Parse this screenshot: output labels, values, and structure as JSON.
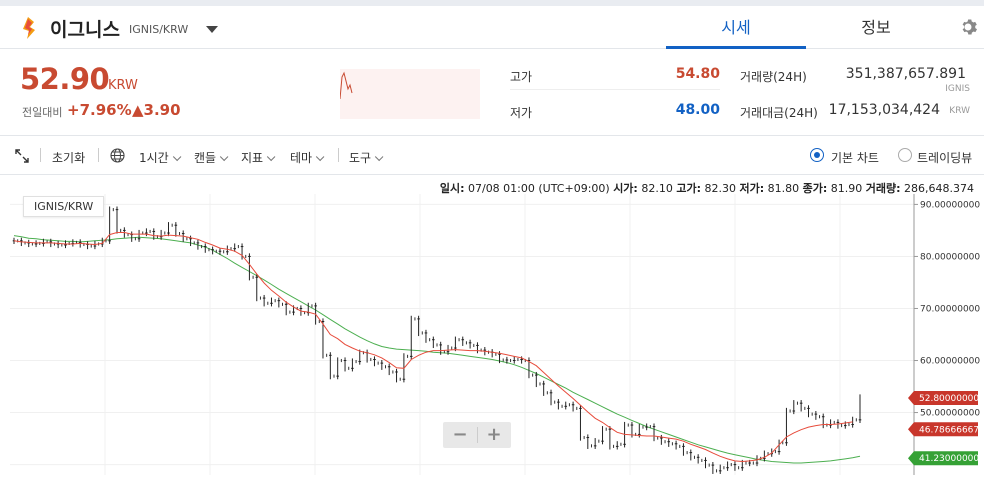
{
  "header": {
    "coin_name": "이그니스",
    "pair": "IGNIS/KRW",
    "tabs": [
      {
        "label": "시세"
      },
      {
        "label": "정보"
      }
    ]
  },
  "price": {
    "value": "52.90",
    "unit": "KRW",
    "change_label": "전일대비",
    "change_rate": "+7.96%",
    "change_amount": "▲3.90"
  },
  "stats": {
    "high_label": "고가",
    "high": "54.80",
    "low_label": "저가",
    "low": "48.00",
    "volume_label": "거래량(24H)",
    "volume": "351,387,657.891",
    "volume_unit": "IGNIS",
    "amount_label": "거래대금(24H)",
    "amount": "17,153,034,424",
    "amount_unit": "KRW"
  },
  "toolbar": {
    "reset": "초기화",
    "interval": "1시간",
    "candle": "캔들",
    "indicator": "지표",
    "theme": "테마",
    "tools": "도구",
    "basic_chart": "기본 차트",
    "trading_view": "트레이딩뷰"
  },
  "ohlc": {
    "date_label": "일시:",
    "date": "07/08 01:00 (UTC+09:00)",
    "open_label": "시가:",
    "open": "82.10",
    "high_label": "고가:",
    "high": "82.30",
    "low_label": "저가:",
    "low": "81.80",
    "close_label": "종가:",
    "close": "81.90",
    "volume_label": "거래량:",
    "volume": "286,648.374"
  },
  "symbol_tag": "IGNIS/KRW",
  "zoom": {
    "minus": "−",
    "plus": "+"
  },
  "colors": {
    "up": "#c84a31",
    "down": "#1261c4",
    "ma_short": "#e74c3c",
    "ma_long": "#4caf50",
    "accent": "#1261c4"
  },
  "chart_data": {
    "type": "line",
    "ylim": [
      38,
      92
    ],
    "y_ticks": [
      "90.00000000",
      "80.00000000",
      "70.00000000",
      "60.00000000",
      "50.00000000"
    ],
    "series": [
      {
        "values": [
          83,
          82.6,
          82.4,
          82.5,
          82.8,
          82.4,
          82.2,
          82.5,
          82.7,
          82.3,
          82,
          82.4,
          83,
          89,
          85,
          84.2,
          83.4,
          84.5,
          84.8,
          83.8,
          84.5,
          86,
          84.4,
          83.4,
          82.6,
          81.9,
          81.3,
          81,
          80.9,
          81.5,
          81.9,
          80,
          76,
          72,
          71,
          71.5,
          70.8,
          69.3,
          70,
          69.2,
          70.5,
          67.5,
          61,
          57,
          60,
          58.5,
          59.8,
          61.5,
          60.2,
          59.5,
          58.8,
          57.8,
          56.4,
          60.8,
          68,
          65.3,
          64,
          63,
          61.7,
          62.4,
          64,
          63.4,
          62.9,
          62,
          61.6,
          61.2,
          60.1,
          60,
          60.2,
          60,
          57.2,
          55.5,
          53.8,
          52,
          51.2,
          51.5,
          50.8,
          45.2,
          43.6,
          44.5,
          46.8,
          43.5,
          43.9,
          47.6,
          45.8,
          47.2,
          47.3,
          45.1,
          44.4,
          44,
          43.5,
          42.3,
          41.4,
          40.8,
          39.9,
          38.8,
          39.4,
          40,
          39.4,
          40.3,
          40.3,
          41.2,
          42.1,
          42.5,
          44.2,
          50.3,
          51.8,
          50.8,
          49.7,
          49.2,
          47.6,
          48.1,
          47.5,
          47.7,
          48.6,
          52.9
        ]
      },
      {
        "values": [
          83,
          82.8,
          82.7,
          82.6,
          82.6,
          82.6,
          82.5,
          82.4,
          82.4,
          82.5,
          82.4,
          82.3,
          82.5,
          84.2,
          84.6,
          84.6,
          84.3,
          84.3,
          84.3,
          84,
          83.9,
          84.1,
          84,
          83.9,
          83.6,
          83.3,
          82.7,
          82.2,
          81.6,
          81.4,
          81,
          80.2,
          78.5,
          76.6,
          74.9,
          73.5,
          72.4,
          71.2,
          70.3,
          69.5,
          69.3,
          68.9,
          67,
          65,
          64.2,
          63.1,
          62.4,
          61.8,
          61.5,
          61.1,
          60.5,
          59.6,
          58.6,
          58.5,
          60.2,
          61,
          61.6,
          61.9,
          61.9,
          62,
          62.1,
          62,
          61.9,
          61.9,
          61.8,
          61.6,
          61.4,
          61.1,
          60.8,
          60.5,
          59.8,
          59,
          57.7,
          56.4,
          55.1,
          53.9,
          52.7,
          51.4,
          50.1,
          48.9,
          48.1,
          47.1,
          46.2,
          45.8,
          45.7,
          45.6,
          45.5,
          45.5,
          45.3,
          45.1,
          44.9,
          44.5,
          43.9,
          43.4,
          42.9,
          42.2,
          41.6,
          41.1,
          40.7,
          40.6,
          40.7,
          40.9,
          41.4,
          42.2,
          43.8,
          45.3,
          46.1,
          46.7,
          47.2,
          47.5,
          47.7,
          47.7,
          47.8,
          48,
          48.2
        ]
      },
      {
        "values": [
          84,
          83.8,
          83.5,
          83.4,
          83.2,
          83.1,
          83,
          82.9,
          82.9,
          82.8,
          82.9,
          83,
          83.1,
          83.2,
          83.4,
          83.5,
          83.6,
          83.7,
          83.6,
          83.5,
          83.4,
          83.2,
          83,
          82.8,
          82.6,
          82.2,
          81.8,
          81.2,
          80.4,
          79.6,
          78.7,
          77.9,
          77.1,
          76.3,
          75.5,
          74.6,
          73.7,
          72.9,
          72.1,
          71.3,
          70.5,
          69.7,
          68.8,
          67.9,
          67,
          66.1,
          65.3,
          64.5,
          63.8,
          63.2,
          62.7,
          62.4,
          62.2,
          62.1,
          62,
          61.9,
          61.8,
          61.6,
          61.5,
          61.4,
          61.2,
          61,
          60.8,
          60.6,
          60.4,
          60.2,
          59.9,
          59.6,
          59.2,
          58.7,
          58.1,
          57.5,
          56.8,
          56.1,
          55.4,
          54.7,
          53.9,
          53.2,
          52.5,
          51.8,
          51.1,
          50.4,
          49.7,
          49.1,
          48.5,
          47.9,
          47.3,
          46.8,
          46.3,
          45.8,
          45.3,
          44.8,
          44.3,
          43.8,
          43.4,
          43,
          42.6,
          42.2,
          41.9,
          41.6,
          41.3,
          41,
          40.8,
          40.6,
          40.5,
          40.4,
          40.3,
          40.3,
          40.4,
          40.5,
          40.6,
          40.7,
          40.9,
          41.1,
          41.3,
          41.6
        ]
      }
    ],
    "badges": [
      {
        "value": "52.80000000",
        "y": 52.8,
        "color": "#c8362b"
      },
      {
        "value": "46.78666667",
        "y": 46.78666667,
        "color": "#c8362b"
      },
      {
        "value": "41.23000000",
        "y": 41.23,
        "color": "#35a135"
      }
    ],
    "grid": true
  }
}
